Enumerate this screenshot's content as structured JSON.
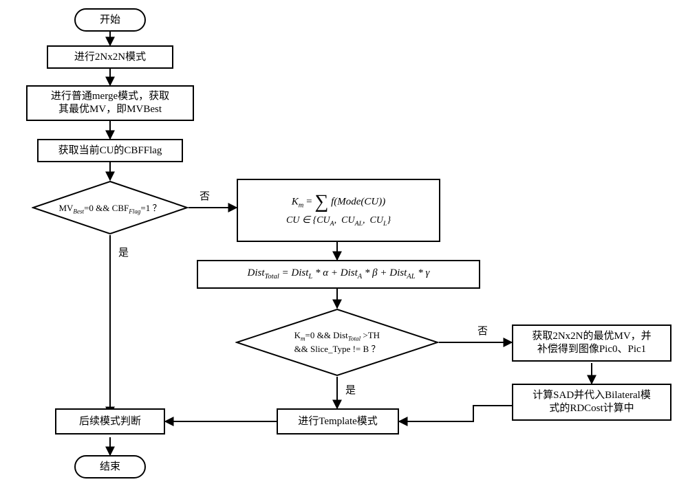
{
  "nodes": {
    "start": "开始",
    "n2nx2n": "进行2Nx2N模式",
    "merge": "进行普通merge模式，获取\n其最优MV，即MVBest",
    "cbfflag": "获取当前CU的CBFFlag",
    "dec1": "MVBest=0 && CBFFlag=1 ？",
    "km_lhs": "K",
    "km_sub": "m",
    "km_eq": " = ",
    "km_sum_lower": "",
    "km_summand": "f(Mode(CU))",
    "km_set": "CU ∈ {CU_A,  CU_AL,  CU_L}",
    "dist": "Dist_Total = Dist_L * α + Dist_A * β + Dist_AL * γ",
    "dec2_l1": "Km=0 && DistTotal >TH",
    "dec2_l2": "&& Slice_Type != B ？",
    "get2n": "获取2Nx2N的最优MV，并\n补偿得到图像Pic0、Pic1",
    "sad": "计算SAD并代入Bilateral模\n式的RDCost计算中",
    "template": "进行Template模式",
    "followup": "后续模式判断",
    "end": "结束"
  },
  "edges": {
    "no": "否",
    "yes": "是"
  },
  "chart_data": {
    "type": "flowchart",
    "title": "",
    "nodes": [
      {
        "id": "start",
        "type": "terminator",
        "label": "开始"
      },
      {
        "id": "n2nx2n",
        "type": "process",
        "label": "进行2Nx2N模式"
      },
      {
        "id": "merge",
        "type": "process",
        "label": "进行普通merge模式，获取其最优MV，即MVBest"
      },
      {
        "id": "cbfflag",
        "type": "process",
        "label": "获取当前CU的CBFFlag"
      },
      {
        "id": "dec1",
        "type": "decision",
        "label": "MVBest=0 && CBFFlag=1 ？"
      },
      {
        "id": "km",
        "type": "formula",
        "label": "K_m = Σ f(Mode(CU)),  CU ∈ {CU_A, CU_AL, CU_L}"
      },
      {
        "id": "dist",
        "type": "formula",
        "label": "Dist_Total = Dist_L * α + Dist_A * β + Dist_AL * γ"
      },
      {
        "id": "dec2",
        "type": "decision",
        "label": "Km=0 && DistTotal > TH && Slice_Type != B ？"
      },
      {
        "id": "get2n",
        "type": "process",
        "label": "获取2Nx2N的最优MV，并补偿得到图像Pic0、Pic1"
      },
      {
        "id": "sad",
        "type": "process",
        "label": "计算SAD并代入Bilateral模式的RDCost计算中"
      },
      {
        "id": "template",
        "type": "process",
        "label": "进行Template模式"
      },
      {
        "id": "followup",
        "type": "process",
        "label": "后续模式判断"
      },
      {
        "id": "end",
        "type": "terminator",
        "label": "结束"
      }
    ],
    "edges": [
      {
        "from": "start",
        "to": "n2nx2n"
      },
      {
        "from": "n2nx2n",
        "to": "merge"
      },
      {
        "from": "merge",
        "to": "cbfflag"
      },
      {
        "from": "cbfflag",
        "to": "dec1"
      },
      {
        "from": "dec1",
        "to": "followup",
        "label": "是"
      },
      {
        "from": "dec1",
        "to": "km",
        "label": "否"
      },
      {
        "from": "km",
        "to": "dist"
      },
      {
        "from": "dist",
        "to": "dec2"
      },
      {
        "from": "dec2",
        "to": "template",
        "label": "是"
      },
      {
        "from": "dec2",
        "to": "get2n",
        "label": "否"
      },
      {
        "from": "get2n",
        "to": "sad"
      },
      {
        "from": "sad",
        "to": "template"
      },
      {
        "from": "template",
        "to": "followup"
      },
      {
        "from": "followup",
        "to": "end"
      }
    ]
  }
}
